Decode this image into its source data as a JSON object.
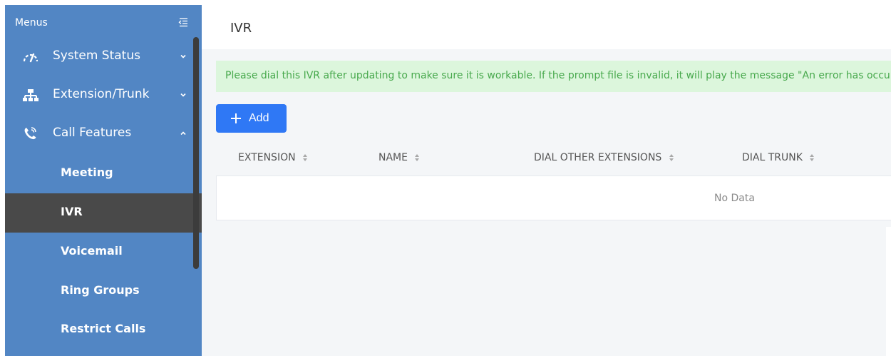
{
  "sidebar": {
    "header": "Menus",
    "items": [
      {
        "label": "System Status",
        "icon": "speedometer-icon",
        "chevron": "down"
      },
      {
        "label": "Extension/Trunk",
        "icon": "network-icon",
        "chevron": "down"
      },
      {
        "label": "Call Features",
        "icon": "phone-call-icon",
        "chevron": "up"
      }
    ],
    "sub_items": [
      {
        "label": "Meeting"
      },
      {
        "label": "IVR",
        "active": true
      },
      {
        "label": "Voicemail"
      },
      {
        "label": "Ring Groups"
      },
      {
        "label": "Restrict Calls"
      }
    ]
  },
  "page": {
    "title": "IVR",
    "notice": "Please dial this IVR after updating to make sure it is workable. If the prompt file is invalid, it will play the message \"An error has occurre",
    "add_label": "Add"
  },
  "table": {
    "columns": [
      "EXTENSION",
      "NAME",
      "DIAL OTHER EXTENSIONS",
      "DIAL TRUNK"
    ],
    "empty_text": "No Data"
  },
  "colors": {
    "sidebar_bg": "#5286c4",
    "active_bg": "#494949",
    "primary": "#2f78f5",
    "notice_bg": "#dcf6dc",
    "notice_text": "#48a94d"
  }
}
